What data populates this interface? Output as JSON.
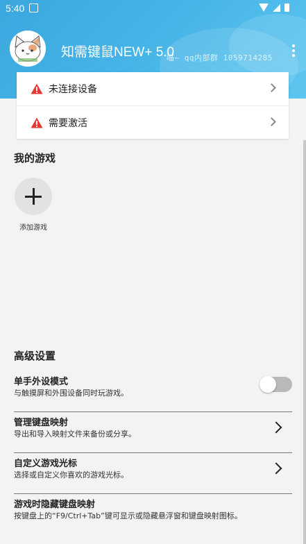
{
  "status_bar": {
    "time": "5:40"
  },
  "header": {
    "title": "知需键鼠NEW+ 5.0",
    "watermark": "喵~ qq内部群 1059714285"
  },
  "device_status": [
    {
      "label": "未连接设备",
      "icon": "warning-icon",
      "color": "#e53935"
    },
    {
      "label": "需要激活",
      "icon": "warning-icon",
      "color": "#e53935"
    }
  ],
  "my_games": {
    "title": "我的游戏",
    "add_label": "添加游戏"
  },
  "advanced": {
    "title": "高级设置",
    "items": [
      {
        "title": "单手外设模式",
        "desc": "与触摸屏和外围设备同时玩游戏。",
        "control": "toggle",
        "enabled": false
      },
      {
        "title": "管理键盘映射",
        "desc": "导出和导入映射文件来备份或分享。",
        "control": "chevron"
      },
      {
        "title": "自定义游戏光标",
        "desc": "选择或自定义你喜欢的游戏光标。",
        "control": "chevron"
      },
      {
        "title": "游戏时隐藏键盘映射",
        "desc": "按键盘上的“F9/Ctrl+Tab”键可显示或隐藏悬浮窗和键盘映射图标。",
        "control": "none"
      }
    ]
  },
  "colors": {
    "header_start": "#3aa8de",
    "header_end": "#5cc6f0",
    "warning": "#e53935"
  }
}
